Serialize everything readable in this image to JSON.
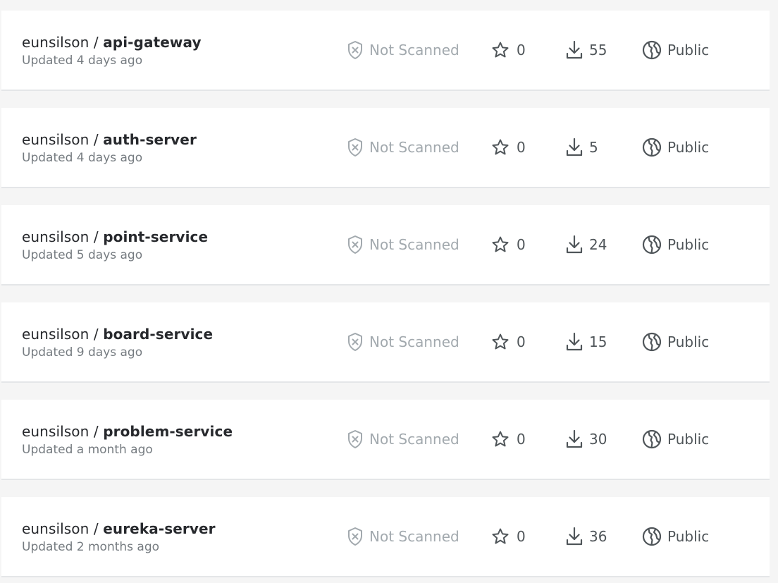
{
  "repositories": [
    {
      "namespace": "eunsilson",
      "separator": " / ",
      "name": "api-gateway",
      "updated": "Updated 4 days ago",
      "scan_status": "Not Scanned",
      "stars": "0",
      "pulls": "55",
      "visibility": "Public"
    },
    {
      "namespace": "eunsilson",
      "separator": " / ",
      "name": "auth-server",
      "updated": "Updated 4 days ago",
      "scan_status": "Not Scanned",
      "stars": "0",
      "pulls": "5",
      "visibility": "Public"
    },
    {
      "namespace": "eunsilson",
      "separator": " / ",
      "name": "point-service",
      "updated": "Updated 5 days ago",
      "scan_status": "Not Scanned",
      "stars": "0",
      "pulls": "24",
      "visibility": "Public"
    },
    {
      "namespace": "eunsilson",
      "separator": " / ",
      "name": "board-service",
      "updated": "Updated 9 days ago",
      "scan_status": "Not Scanned",
      "stars": "0",
      "pulls": "15",
      "visibility": "Public"
    },
    {
      "namespace": "eunsilson",
      "separator": " / ",
      "name": "problem-service",
      "updated": "Updated a month ago",
      "scan_status": "Not Scanned",
      "stars": "0",
      "pulls": "30",
      "visibility": "Public"
    },
    {
      "namespace": "eunsilson",
      "separator": " / ",
      "name": "eureka-server",
      "updated": "Updated 2 months ago",
      "scan_status": "Not Scanned",
      "stars": "0",
      "pulls": "36",
      "visibility": "Public"
    }
  ],
  "icons": {
    "scan": "shield-x-icon",
    "stars": "star-icon",
    "pulls": "download-icon",
    "visibility": "globe-icon"
  },
  "colors": {
    "page_background": "#f5f5f5",
    "card_background": "#ffffff",
    "primary_text": "#27292d",
    "secondary_text": "#757b80",
    "muted_text": "#a2a9ae",
    "stat_text": "#4f5559"
  }
}
